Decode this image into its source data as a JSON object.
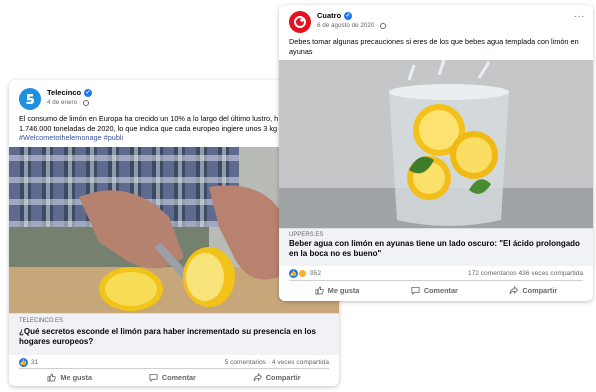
{
  "posts": {
    "telecinco": {
      "author": "Telecinco",
      "date": "4 de enero ·",
      "text_line1": "El consumo de limón en Europa ha crecido un 10% a lo largo del último lustro, h",
      "text_line2": "1.746.000 toneladas de 2020, lo que indica que cada europeo ingiere unos 3 kg",
      "hashtags": "#Welcometothelemonage #publi",
      "link_domain": "TELECINCO.ES",
      "link_title": "¿Qué secretos esconde el limón para haber incrementado su presencia en los hogares europeos?",
      "reaction_count": "31",
      "stats": "5 comentarios · 4 veces compartida",
      "actions": {
        "like": "Me gusta",
        "comment": "Comentar",
        "share": "Compartir"
      },
      "colors": {
        "logo": "#1f8fe0"
      }
    },
    "cuatro": {
      "author": "Cuatro",
      "date": "6 de agosto de 2020 ·",
      "more": "···",
      "text_line1": "Debes tomar algunas precauciones si eres de los que bebes agua templada con limón en",
      "text_line2": "ayunas",
      "link_domain": "UPPERS.ES",
      "link_title": "Beber agua con limón en ayunas tiene un lado oscuro: \"El ácido prolongado en la boca no es bueno\"",
      "reaction_count": "952",
      "stats": "172 comentarios  436 veces compartida",
      "actions": {
        "like": "Me gusta",
        "comment": "Comentar",
        "share": "Compartir"
      },
      "colors": {
        "logo": "#e4111f"
      }
    }
  }
}
